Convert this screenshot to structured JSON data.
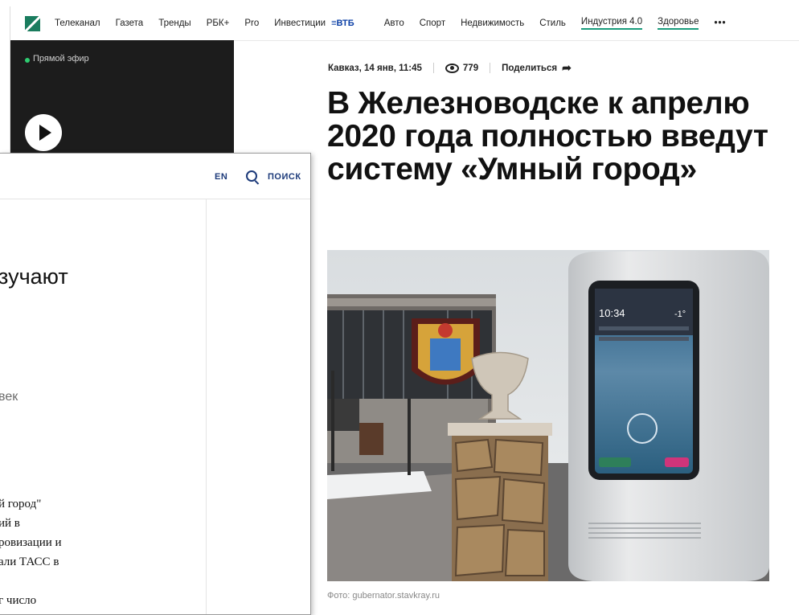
{
  "rbc": {
    "nav": [
      "Телеканал",
      "Газета",
      "Тренды",
      "РБК+",
      "Pro",
      "Инвестиции"
    ],
    "nav_vtb": "ВТБ",
    "nav_after": [
      "Авто",
      "Спорт",
      "Недвижимость",
      "Стиль"
    ],
    "nav_underlined": [
      "Индустрия 4.0",
      "Здоровье"
    ],
    "nav_more": "•••",
    "live_label": "Прямой эфир",
    "meta": {
      "location_time": "Кавказ, 14 янв, 11:45",
      "views": "779",
      "share": "Поделиться"
    },
    "headline": "В Железноводске к апрелю 2020 года полностью введут систему «Умный город»",
    "photo_caption": "Фото: gubernator.stavkray.ru",
    "kiosk_time": "10:34",
    "kiosk_temp": "-1°",
    "accent": "#1a9c7c"
  },
  "tass": {
    "lang": "EN",
    "search": "ПОИСК",
    "title_fragment": "зучают",
    "subtitle_fragment": "век",
    "body_lines": [
      "й город\"",
      "ий в",
      "ровизации и",
      "али ТАСС в",
      "",
      "г число"
    ],
    "accent": "#1c3a7a"
  }
}
